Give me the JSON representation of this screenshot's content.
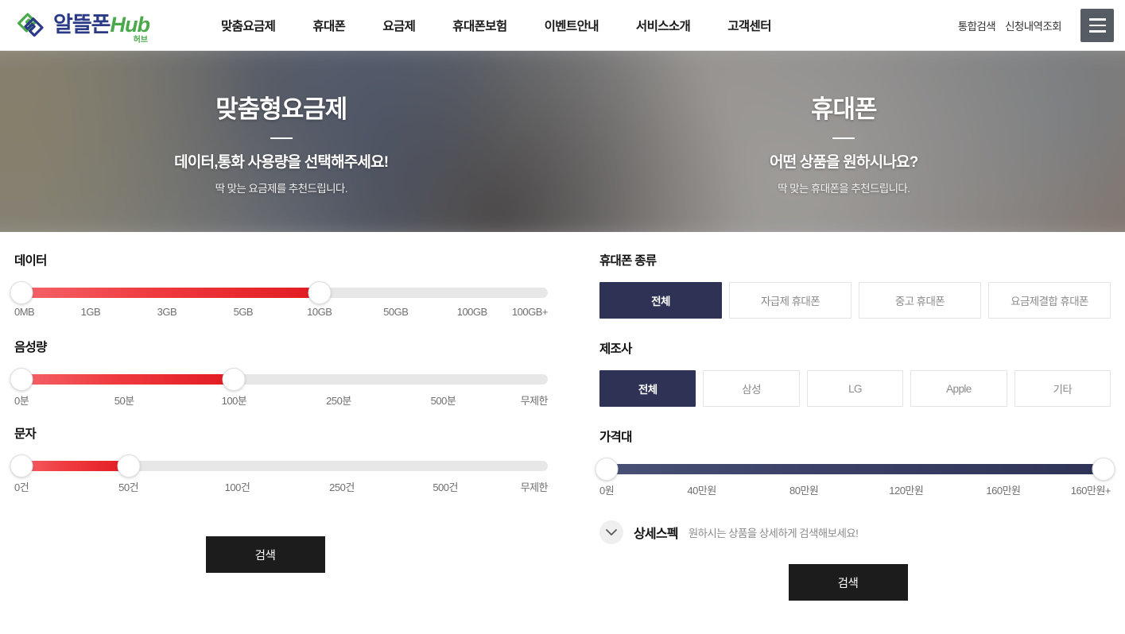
{
  "header": {
    "logo": {
      "brand": "알뜰폰",
      "hub": "Hub",
      "sub": "허브",
      "icon": "interlocking-rings-logo"
    },
    "nav": [
      {
        "label": "맞춤요금제"
      },
      {
        "label": "휴대폰"
      },
      {
        "label": "요금제"
      },
      {
        "label": "휴대폰보험"
      },
      {
        "label": "이벤트안내"
      },
      {
        "label": "서비스소개"
      },
      {
        "label": "고객센터"
      }
    ],
    "utils": [
      {
        "label": "통합검색"
      },
      {
        "label": "신청내역조회"
      }
    ],
    "menu_icon": "hamburger-icon"
  },
  "hero": {
    "left": {
      "title": "맞춤형요금제",
      "subtitle": "데이터,통화 사용량을 선택해주세요!",
      "description": "딱 맞는 요금제를 추천드립니다."
    },
    "right": {
      "title": "휴대폰",
      "subtitle": "어떤 상품을 원하시나요?",
      "description": "딱 맞는 휴대폰을 추천드립니다."
    }
  },
  "plan_panel": {
    "sliders": [
      {
        "label": "데이터",
        "ticks": [
          "0MB",
          "1GB",
          "3GB",
          "5GB",
          "10GB",
          "50GB",
          "100GB",
          "100GB+"
        ],
        "start_percent": 0,
        "end_percent": 57.2,
        "selected_min": "0MB",
        "selected_max": "10GB",
        "fill_color": "#e11b22"
      },
      {
        "label": "음성량",
        "ticks": [
          "0분",
          "50분",
          "100분",
          "250분",
          "500분",
          "무제한"
        ],
        "start_percent": 0,
        "end_percent": 41.2,
        "selected_min": "0분",
        "selected_max": "100분",
        "fill_color": "#e11b22"
      },
      {
        "label": "문자",
        "ticks": [
          "0건",
          "50건",
          "100건",
          "250건",
          "500건",
          "무제한"
        ],
        "start_percent": 0,
        "end_percent": 21.4,
        "selected_min": "0건",
        "selected_max": "50건",
        "fill_color": "#e11b22"
      }
    ],
    "search_label": "검색"
  },
  "phone_panel": {
    "phone_type": {
      "label": "휴대폰 종류",
      "options": [
        "전체",
        "자급제 휴대폰",
        "중고 휴대폰",
        "요금제결합 휴대폰"
      ],
      "selected": "전체"
    },
    "manufacturer": {
      "label": "제조사",
      "options": [
        "전체",
        "삼성",
        "LG",
        "Apple",
        "기타"
      ],
      "selected": "전체"
    },
    "price": {
      "label": "가격대",
      "ticks": [
        "0원",
        "40만원",
        "80만원",
        "120만원",
        "160만원",
        "160만원+"
      ],
      "start_percent": 0,
      "end_percent": 100,
      "selected_min": "0원",
      "selected_max": "160만원+",
      "fill_color": "#2e3356"
    },
    "detail_spec": {
      "icon": "chevron-down-icon",
      "title": "상세스펙",
      "hint": "원하시는 상품을 상세하게 검색해보세요!"
    },
    "search_label": "검색"
  }
}
